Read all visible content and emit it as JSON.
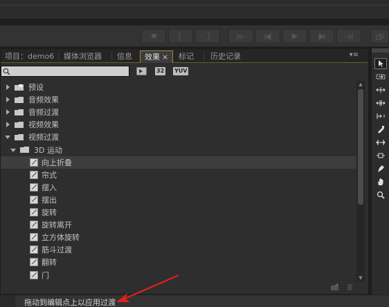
{
  "tabs": [
    {
      "label": "项目：demo6",
      "active": false
    },
    {
      "label": "媒体浏览器",
      "active": false
    },
    {
      "label": "信息",
      "active": false
    },
    {
      "label": "效果",
      "active": true,
      "close": "×"
    },
    {
      "label": "标记",
      "active": false
    },
    {
      "label": "历史记录",
      "active": false
    }
  ],
  "panel_menu_icon": "panel-menu-icon",
  "search": {
    "value": "",
    "placeholder": "",
    "icon": "search-icon"
  },
  "toolbar_badges": [
    "32",
    "YUV"
  ],
  "tree": [
    {
      "label": "预设",
      "level": 0,
      "kind": "folder",
      "expanded": false
    },
    {
      "label": "音频效果",
      "level": 0,
      "kind": "folder",
      "expanded": false
    },
    {
      "label": "音频过渡",
      "level": 0,
      "kind": "folder",
      "expanded": false
    },
    {
      "label": "视频效果",
      "level": 0,
      "kind": "folder",
      "expanded": false
    },
    {
      "label": "视频过渡",
      "level": 0,
      "kind": "folder",
      "expanded": true
    },
    {
      "label": "3D 运动",
      "level": 1,
      "kind": "folder",
      "expanded": true
    },
    {
      "label": "向上折叠",
      "level": 2,
      "kind": "effect",
      "selected": true
    },
    {
      "label": "帘式",
      "level": 2,
      "kind": "effect"
    },
    {
      "label": "摆入",
      "level": 2,
      "kind": "effect"
    },
    {
      "label": "摆出",
      "level": 2,
      "kind": "effect"
    },
    {
      "label": "旋转",
      "level": 2,
      "kind": "effect"
    },
    {
      "label": "旋转离开",
      "level": 2,
      "kind": "effect"
    },
    {
      "label": "立方体旋转",
      "level": 2,
      "kind": "effect"
    },
    {
      "label": "筋斗过渡",
      "level": 2,
      "kind": "effect"
    },
    {
      "label": "翻转",
      "level": 2,
      "kind": "effect"
    },
    {
      "label": "门",
      "level": 2,
      "kind": "effect"
    }
  ],
  "tools": [
    "selection-tool-icon",
    "track-select-tool-icon",
    "ripple-edit-tool-icon",
    "rolling-edit-tool-icon",
    "rate-stretch-tool-icon",
    "razor-tool-icon",
    "slip-tool-icon",
    "slide-tool-icon",
    "pen-tool-icon",
    "hand-tool-icon",
    "zoom-tool-icon"
  ],
  "status": {
    "text": "拖动到编辑点上以应用过渡"
  },
  "colors": {
    "accent": "#a08a3c",
    "annotation_arrow": "#e02020",
    "panel_bg": "#2e2e2e"
  }
}
